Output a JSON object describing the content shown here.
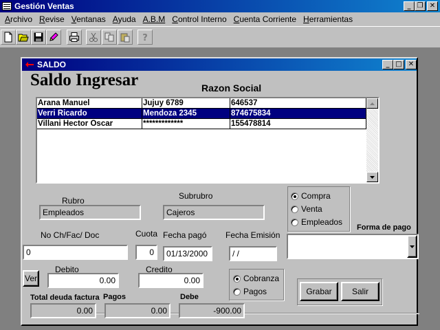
{
  "app": {
    "title": "Gestión Ventas"
  },
  "menu": [
    {
      "label_ul": "A",
      "label_rest": "rchivo"
    },
    {
      "label_ul": "R",
      "label_rest": "evise"
    },
    {
      "label_ul": "V",
      "label_rest": "entanas"
    },
    {
      "label_ul": "A",
      "label_rest": "yuda"
    },
    {
      "label_ul": "A.B.M",
      "label_rest": ""
    },
    {
      "label_ul": "C",
      "label_rest": "ontrol Interno"
    },
    {
      "label_ul": "C",
      "label_rest": "uenta Corriente"
    },
    {
      "label_ul": "H",
      "label_rest": "erramientas"
    }
  ],
  "toolbar": [
    "new-file-icon",
    "open-folder-icon",
    "save-icon",
    "edit-pencil-icon",
    "print-icon",
    "cut-icon",
    "copy-icon",
    "paste-icon",
    "help-icon"
  ],
  "window": {
    "title": "SALDO",
    "heading": "Saldo Ingresar",
    "razon_social_label": "Razon Social"
  },
  "grid": {
    "rows": [
      {
        "name": "Arana Manuel",
        "address": "Jujuy 6789",
        "phone": "646537",
        "selected": false
      },
      {
        "name": "Verri Ricardo",
        "address": "Mendoza 2345",
        "phone": "874675834",
        "selected": true
      },
      {
        "name": "Villani Hector Oscar",
        "address": "*************",
        "phone": "155478814",
        "selected": false
      }
    ]
  },
  "rubro": {
    "label": "Rubro",
    "value": "Empleados"
  },
  "subrubro": {
    "label": "Subrubro",
    "value": "Cajeros"
  },
  "tipo": {
    "options": [
      {
        "label": "Compra",
        "checked": true
      },
      {
        "label": "Venta",
        "checked": false
      },
      {
        "label": "Empleados",
        "checked": false
      }
    ]
  },
  "forma_pago": {
    "label": "Forma de pago",
    "value": ""
  },
  "doc": {
    "label": "No Ch/Fac/ Doc",
    "value": "0"
  },
  "cuota": {
    "label": "Cuota",
    "value": "0"
  },
  "fecha_pago": {
    "label": "Fecha pagó",
    "value": "01/13/2000"
  },
  "fecha_emision": {
    "label": "Fecha  Emisión",
    "value": " / /"
  },
  "ver_button": "Ver",
  "debito": {
    "label": "Debito",
    "value": "0.00"
  },
  "credito": {
    "label": "Credito",
    "value": "0.00"
  },
  "movimiento": {
    "options": [
      {
        "label": "Cobranza",
        "checked": true
      },
      {
        "label": "Pagos",
        "checked": false
      }
    ]
  },
  "grabar_button": "Grabar",
  "salir_button": "Salir",
  "totals": {
    "total_label": "Total deuda factura",
    "total_value": "0.00",
    "pagos_label": "Pagos",
    "pagos_value": "0.00",
    "debe_label": "Debe",
    "debe_value": "-900.00"
  },
  "colors": {
    "title_bar": "#000080",
    "face": "#c0c0c0",
    "selection": "#000080",
    "desktop": "#808080"
  }
}
